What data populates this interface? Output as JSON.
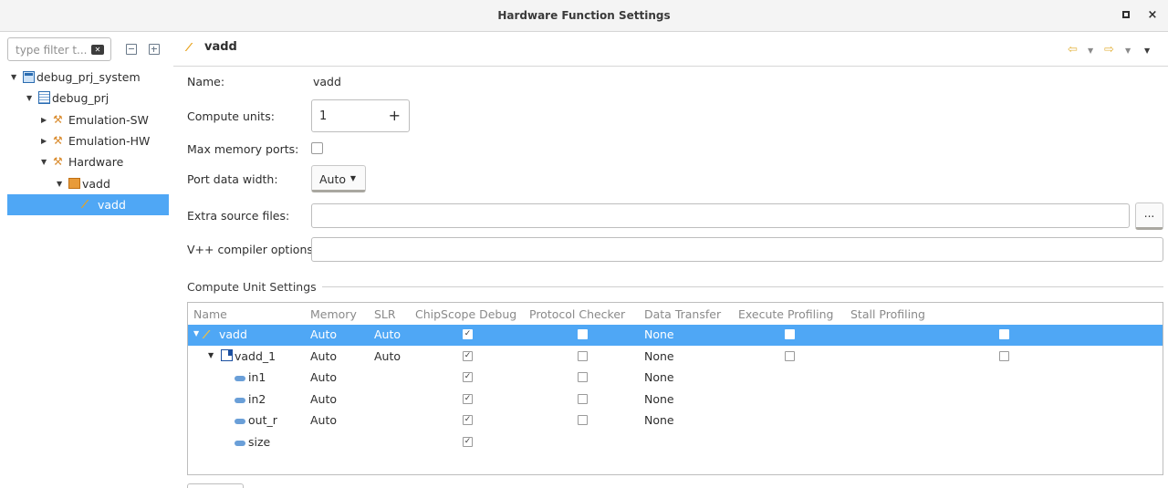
{
  "window": {
    "title": "Hardware Function Settings",
    "restore_icon": "square-icon",
    "close_label": "×"
  },
  "sidebar": {
    "filter_placeholder": "type filter t...",
    "tree": [
      {
        "label": "debug_prj_system",
        "icon": "system-project-icon",
        "expanded": true
      },
      {
        "label": "debug_prj",
        "icon": "project-icon",
        "expanded": true
      },
      {
        "label": "Emulation-SW",
        "icon": "hammer-icon",
        "expanded": false
      },
      {
        "label": "Emulation-HW",
        "icon": "hammer-icon",
        "expanded": false
      },
      {
        "label": "Hardware",
        "icon": "hammer-icon",
        "expanded": true
      },
      {
        "label": "vadd",
        "icon": "accelerator-icon",
        "expanded": true
      },
      {
        "label": "vadd",
        "icon": "function-icon",
        "selected": true
      }
    ]
  },
  "header": {
    "function_name": "vadd"
  },
  "form": {
    "name_label": "Name:",
    "name_value": "vadd",
    "cu_label": "Compute units:",
    "cu_value": "1",
    "cu_plus": "+",
    "maxmem_label": "Max memory ports:",
    "pdw_label": "Port data width:",
    "pdw_value": "Auto",
    "extra_label": "Extra source files:",
    "browse_label": "...",
    "vpp_label": "V++ compiler options:"
  },
  "cu_settings": {
    "title": "Compute Unit Settings",
    "columns": [
      "Name",
      "Memory",
      "SLR",
      "ChipScope Debug",
      "Protocol Checker",
      "Data Transfer",
      "Execute Profiling",
      "Stall Profiling"
    ],
    "rows": [
      {
        "name": "vadd",
        "memory": "Auto",
        "slr": "Auto",
        "chipscope": true,
        "protocol": false,
        "transfer": "None",
        "exec_prof": false,
        "stall_prof": false,
        "selected": true
      },
      {
        "name": "vadd_1",
        "memory": "Auto",
        "slr": "Auto",
        "chipscope": true,
        "protocol": false,
        "transfer": "None",
        "exec_prof": false,
        "stall_prof": false
      },
      {
        "name": "in1",
        "memory": "Auto",
        "slr": "",
        "chipscope": true,
        "protocol": false,
        "transfer": "None"
      },
      {
        "name": "in2",
        "memory": "Auto",
        "slr": "",
        "chipscope": true,
        "protocol": false,
        "transfer": "None"
      },
      {
        "name": "out_r",
        "memory": "Auto",
        "slr": "",
        "chipscope": true,
        "protocol": false,
        "transfer": "None"
      },
      {
        "name": "size",
        "memory": "",
        "slr": "",
        "chipscope": true
      }
    ]
  },
  "colors": {
    "selection": "#4fa7f5",
    "accent_orange": "#e89b3a",
    "nav_arrow": "#e3b23c"
  }
}
